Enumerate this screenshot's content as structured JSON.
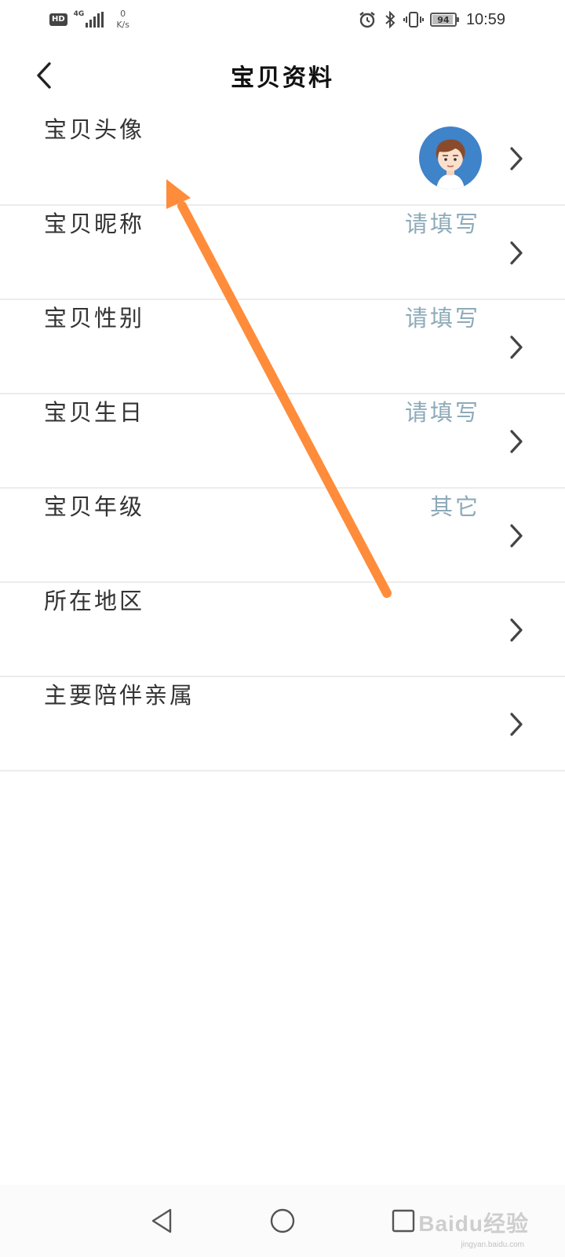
{
  "status_bar": {
    "hd": "HD",
    "network": "4G",
    "speed_value": "0",
    "speed_unit": "K/s",
    "battery_level": 94,
    "battery_text": "94",
    "time": "10:59",
    "icons": [
      "alarm-icon",
      "bluetooth-icon",
      "vibrate-icon",
      "battery-icon"
    ]
  },
  "header": {
    "title": "宝贝资料",
    "back_icon": "chevron-left-icon"
  },
  "rows": [
    {
      "label": "宝贝头像",
      "value": "",
      "kind": "avatar"
    },
    {
      "label": "宝贝昵称",
      "value": "请填写"
    },
    {
      "label": "宝贝性别",
      "value": "请填写"
    },
    {
      "label": "宝贝生日",
      "value": "请填写"
    },
    {
      "label": "宝贝年级",
      "value": "其它"
    },
    {
      "label": "所在地区",
      "value": ""
    },
    {
      "label": "主要陪伴亲属",
      "value": ""
    }
  ],
  "colors": {
    "value_text": "#8eaab8",
    "annotation_arrow": "#ff8c3a",
    "avatar_bg": "#3f83c9"
  },
  "nav_bar": {
    "buttons": [
      "back-triangle-icon",
      "home-circle-icon",
      "recents-square-icon"
    ]
  },
  "watermark": {
    "brand": "Baidu经验",
    "url": "jingyan.baidu.com"
  }
}
